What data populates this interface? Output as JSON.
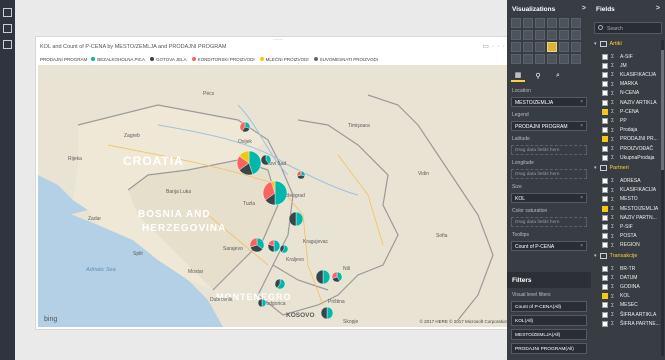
{
  "visual": {
    "title": "KOL and Count of P-CENA by MESTO/ZEMLJA and PRODAJNI PROGRAM",
    "legend_title": "PRODAJNI PROGRAM",
    "legend": [
      {
        "label": "BEZALKOHOLNA PICA",
        "color": "#01b8aa"
      },
      {
        "label": "GOTOVA JELA",
        "color": "#374649"
      },
      {
        "label": "KONDITORSKI PROIZVODI",
        "color": "#fd625e"
      },
      {
        "label": "MLEČNI PROIZVODI",
        "color": "#f2c80f"
      },
      {
        "label": "SUVOMESNATI PROIZVODI",
        "color": "#5f6b6d"
      }
    ]
  },
  "map": {
    "countries": [
      "CROATIA",
      "BOSNIA AND",
      "HERZEGOVINA",
      "MONTENEGRO",
      "KOSOVO"
    ],
    "sea": "Adriatic Sea",
    "cities": [
      "Zagreb",
      "Rijeka",
      "Zadar",
      "Split",
      "Sarajevo",
      "Mostar",
      "Podgorica",
      "Priština",
      "Skopje",
      "Novi Sad",
      "Beograd",
      "Kragujevac",
      "Niš",
      "Sofia",
      "Timişoara",
      "Pécs",
      "Osijek",
      "Banja Luka",
      "Dubrovnik",
      "Kraljevo",
      "Tuzla",
      "Vidin"
    ],
    "provider": "bing",
    "copyright": "© 2017 HERE  © 2017 Microsoft Corporation"
  },
  "viz_pane": {
    "title": "Visualizations",
    "chevron": ">",
    "wells": [
      {
        "label": "Location",
        "value": "MESTO/ZEMLJA"
      },
      {
        "label": "Legend",
        "value": "PRODAJNI PROGRAM"
      },
      {
        "label": "Latitude",
        "placeholder": "Drag data fields here"
      },
      {
        "label": "Longitude",
        "placeholder": "Drag data fields here"
      },
      {
        "label": "Size",
        "value": "KOL"
      },
      {
        "label": "Color saturation",
        "placeholder": "Drag data fields here"
      },
      {
        "label": "Tooltips",
        "value": "Count of P-CENA"
      }
    ],
    "filters_title": "Filters",
    "filters_label": "Visual level filters",
    "filters": [
      "Count of P-CENA(All)",
      "KOL(All)",
      "MESTO/ZEMLJA(All)",
      "PRODAJNI PROGRAM(All)"
    ]
  },
  "fields_pane": {
    "title": "Fields",
    "chevron": ">",
    "search_placeholder": "Search",
    "tables": [
      {
        "name": "Artikl",
        "fields": [
          {
            "label": "A-SIF",
            "checked": false
          },
          {
            "label": "JM",
            "checked": false
          },
          {
            "label": "KLASIFIKACIJA",
            "checked": false
          },
          {
            "label": "MARKA",
            "checked": false
          },
          {
            "label": "N-CENA",
            "checked": false
          },
          {
            "label": "NAZIV ARTIKLA",
            "checked": false
          },
          {
            "label": "P-CENA",
            "checked": true
          },
          {
            "label": "PP",
            "checked": false
          },
          {
            "label": "Prodaja",
            "checked": false
          },
          {
            "label": "PRODAJNI PR...",
            "checked": true
          },
          {
            "label": "PROIZVOĐAČ",
            "checked": false
          },
          {
            "label": "UkupnaProdaja",
            "checked": false
          }
        ]
      },
      {
        "name": "Partneri",
        "fields": [
          {
            "label": "ADRESA",
            "checked": false
          },
          {
            "label": "KLASIFIKACIJA",
            "checked": false
          },
          {
            "label": "MESTO",
            "checked": false
          },
          {
            "label": "MESTO/ZEMLJA",
            "checked": true
          },
          {
            "label": "NAZIV PARTN...",
            "checked": false
          },
          {
            "label": "P-SIF",
            "checked": false
          },
          {
            "label": "POSTA",
            "checked": false
          },
          {
            "label": "REGION",
            "checked": false
          }
        ]
      },
      {
        "name": "Transakcije",
        "fields": [
          {
            "label": "BR-TR",
            "checked": false
          },
          {
            "label": "DATUM",
            "checked": false
          },
          {
            "label": "GODINA",
            "checked": false
          },
          {
            "label": "KOL",
            "checked": true
          },
          {
            "label": "MESEC",
            "checked": false
          },
          {
            "label": "ŠIFRA ARTIKLA",
            "checked": false
          },
          {
            "label": "ŠIFRA PARTNE...",
            "checked": false
          }
        ]
      }
    ]
  },
  "colors": {
    "accent": "#f2c811",
    "pane_bg": "#383d44",
    "map_land": "#e9e3d3",
    "map_water": "#b4d0e6"
  },
  "bubbles": [
    {
      "place": "Sombor",
      "slices": [
        0.3,
        0.3,
        0.4
      ]
    },
    {
      "place": "Novi Sad",
      "slices": [
        0.45,
        0.2,
        0.2,
        0.15
      ]
    },
    {
      "place": "Beograd",
      "slices": [
        0.5,
        0.15,
        0.3,
        0.05
      ]
    },
    {
      "place": "Ruma",
      "slices": [
        0.4,
        0.6
      ]
    },
    {
      "place": "Pančevo",
      "slices": [
        0.3,
        0.4,
        0.3
      ]
    },
    {
      "place": "Kragujevac",
      "slices": [
        0.5,
        0.5
      ]
    },
    {
      "place": "Čačak",
      "slices": [
        0.35,
        0.35,
        0.3
      ]
    },
    {
      "place": "Kraljevo",
      "slices": [
        0.5,
        0.3,
        0.2
      ]
    },
    {
      "place": "Kruševac",
      "slices": [
        0.6,
        0.4
      ]
    },
    {
      "place": "Niš",
      "slices": [
        0.5,
        0.5
      ]
    },
    {
      "place": "Leskovac",
      "slices": [
        0.4,
        0.3,
        0.3
      ]
    },
    {
      "place": "Vranje",
      "slices": [
        0.5,
        0.5
      ]
    },
    {
      "place": "Novi Pazar",
      "slices": [
        0.6,
        0.4
      ]
    },
    {
      "place": "Užice",
      "slices": [
        0.5,
        0.5
      ]
    }
  ]
}
